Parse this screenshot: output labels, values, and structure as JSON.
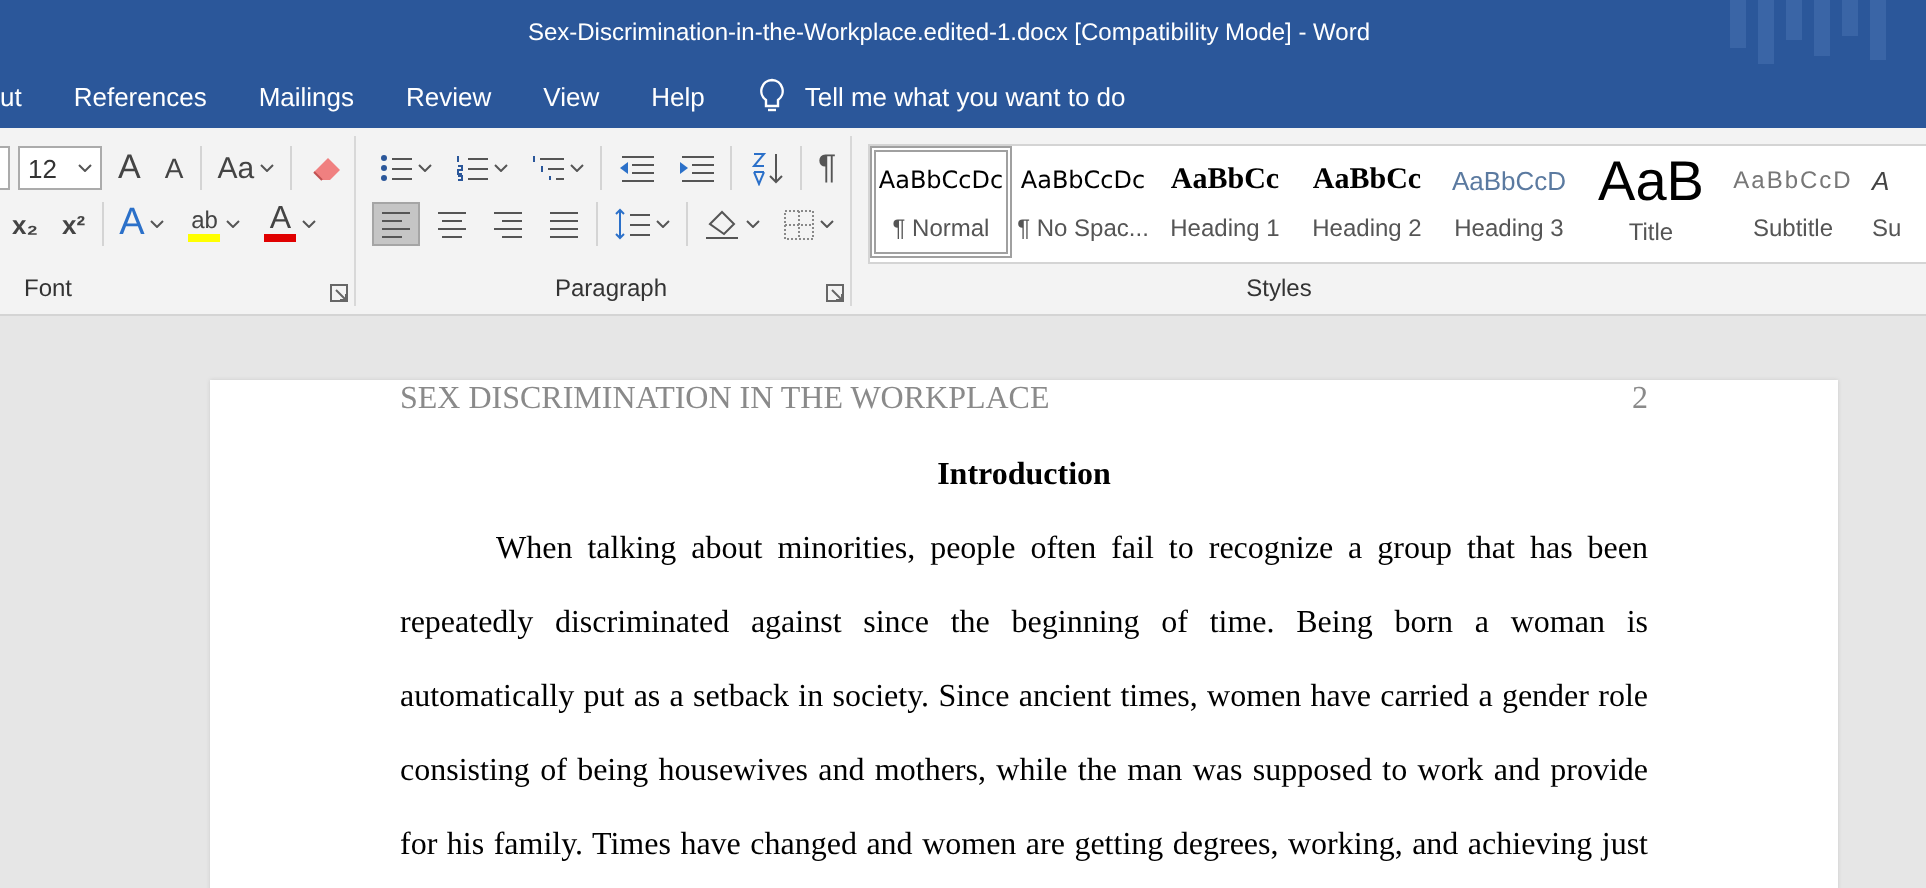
{
  "window": {
    "title": "Sex-Discrimination-in-the-Workplace.edited-1.docx [Compatibility Mode]  -  Word"
  },
  "tabs": [
    {
      "label": "ut",
      "selected": false
    },
    {
      "label": "References",
      "selected": false
    },
    {
      "label": "Mailings",
      "selected": false
    },
    {
      "label": "Review",
      "selected": false
    },
    {
      "label": "View",
      "selected": false
    },
    {
      "label": "Help",
      "selected": false
    }
  ],
  "tell_me": {
    "placeholder": "Tell me what you want to do"
  },
  "font_group": {
    "label": "Font",
    "size": "12",
    "row1": [
      {
        "kind": "grow",
        "glyph": "A"
      },
      {
        "kind": "shrink",
        "glyph": "A"
      },
      {
        "kind": "case",
        "glyph": "Aa"
      },
      {
        "kind": "clear"
      }
    ],
    "row2": [
      {
        "kind": "subscript",
        "glyph": "x₂"
      },
      {
        "kind": "superscript",
        "glyph": "x²"
      },
      {
        "kind": "effects",
        "glyph": "A"
      },
      {
        "kind": "highlight",
        "glyph": "ab",
        "color": "#ffff00"
      },
      {
        "kind": "fontcolor",
        "glyph": "A",
        "color": "#e00000"
      }
    ]
  },
  "paragraph_group": {
    "label": "Paragraph",
    "pilcrow": "¶",
    "alignment": [
      {
        "kind": "left",
        "selected": true
      },
      {
        "kind": "center",
        "selected": false
      },
      {
        "kind": "right",
        "selected": false
      },
      {
        "kind": "justify",
        "selected": false
      }
    ]
  },
  "styles_group": {
    "label": "Styles",
    "items": [
      {
        "kind": "normal",
        "preview": "AaBbCcDc",
        "label": "¶ Normal",
        "selected": true
      },
      {
        "kind": "nospacing",
        "preview": "AaBbCcDc",
        "label": "¶ No Spac...",
        "selected": false
      },
      {
        "kind": "heading1",
        "preview": "AaBbCc",
        "label": "Heading 1",
        "selected": false
      },
      {
        "kind": "heading2",
        "preview": "AaBbCc",
        "label": "Heading 2",
        "selected": false
      },
      {
        "kind": "heading3",
        "preview": "AaBbCcD",
        "label": "Heading 3",
        "selected": false
      },
      {
        "kind": "title",
        "preview": "AaB",
        "label": "Title",
        "selected": false
      },
      {
        "kind": "subtitle",
        "preview": "AaBbCcD",
        "label": "Subtitle",
        "selected": false
      },
      {
        "kind": "emphasis",
        "preview": "A",
        "label": "Su",
        "selected": false
      }
    ]
  },
  "document": {
    "header": "SEX DISCRIMINATION IN THE WORKPLACE",
    "page_number": "2",
    "heading": "Introduction",
    "paragraph": "When talking about minorities, people often fail to recognize a group that has been repeatedly discriminated against since the beginning of time. Being born a woman is automatically put as a setback in society. Since ancient times, women have carried a gender role consisting of being housewives and mothers, while the man was supposed to work and provide for his family. Times have changed and women are getting degrees, working, and achieving just"
  }
}
